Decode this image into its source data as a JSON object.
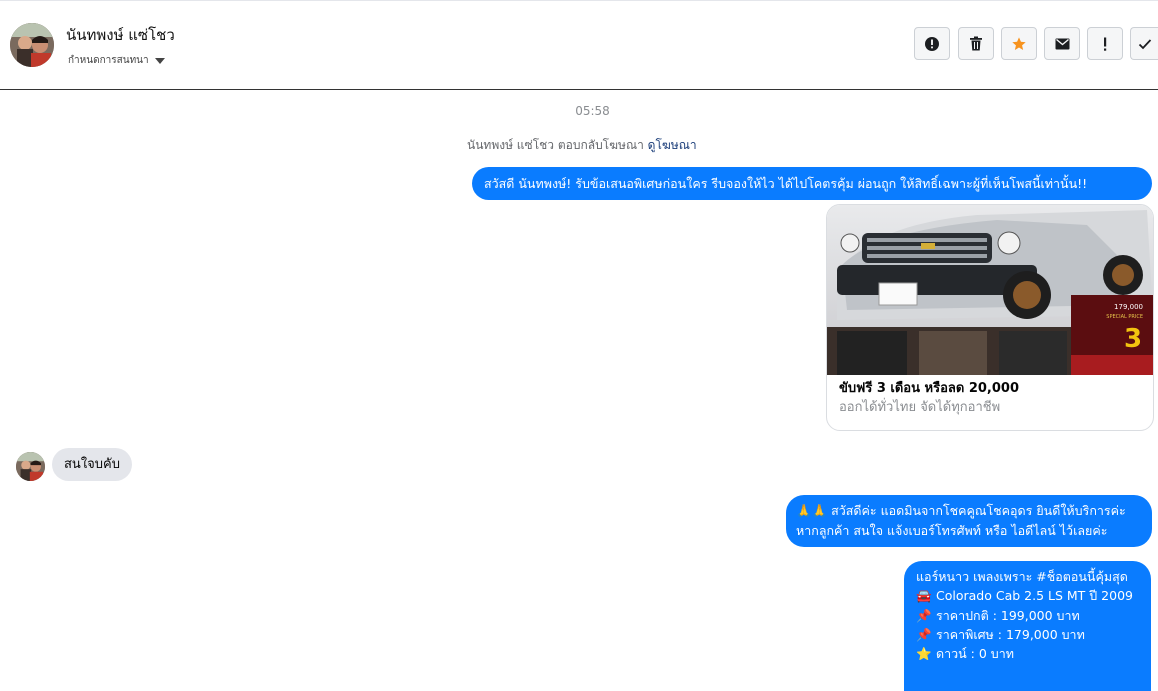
{
  "header": {
    "name": "นันทพงษ์ แซ่โชว",
    "sub_label": "กำหนดการสนทนา",
    "toolbar_icons": [
      "alert-circle-icon",
      "trash-icon",
      "star-icon",
      "envelope-icon",
      "exclamation-icon",
      "check-icon"
    ],
    "star_color": "#f7931e"
  },
  "thread": {
    "time": "05:58",
    "reply_prefix": "นันทพงษ์ แซ่โชว ตอบกลับโฆษณา",
    "reply_link": "ดูโฆษณา",
    "greeting": "สวัสดี นันทพงษ์! รับข้อเสนอพิเศษก่อนใคร รีบจองให้ไว ได้ไปโคตรคุ้ม ผ่อนถูก ให้สิทธิ์เฉพาะผู้ที่เห็นโพสนี้เท่านั้น!!",
    "ad_card": {
      "title": "ขับฟรี 3 เดือน หรือลด 20,000",
      "desc": "ออกได้ทั่วไทย จัดได้ทุกอาชีพ",
      "img_price": "179,000",
      "img_special": "SPECIAL PRICE",
      "img_big": "3"
    },
    "customer_msg": "สนใจบคับ",
    "reply1_line1": "สวัสดีค่ะ แอดมินจากโชคคูณโชคอุดร ยินดีให้บริการค่ะ",
    "reply1_line2": "หากลูกค้า สนใจ แจ้งเบอร์โทรศัพท์ หรือ ไอดีไลน์  ไว้เลยค่ะ",
    "reply1_emoji": "🙏🙏",
    "offer": {
      "l1": "แอร์หนาว เพลงเพราะ #ช็อตอนนี้คุ้มสุด",
      "l2": "Colorado Cab 2.5 LS MT ปี 2009",
      "l3": "ราคาปกติ : 199,000 บาท",
      "l4": "ราคาพิเศษ : 179,000 บาท",
      "l5": "ดาวน์ : 0 บาท"
    },
    "bubble_color": "#0a7cff"
  }
}
